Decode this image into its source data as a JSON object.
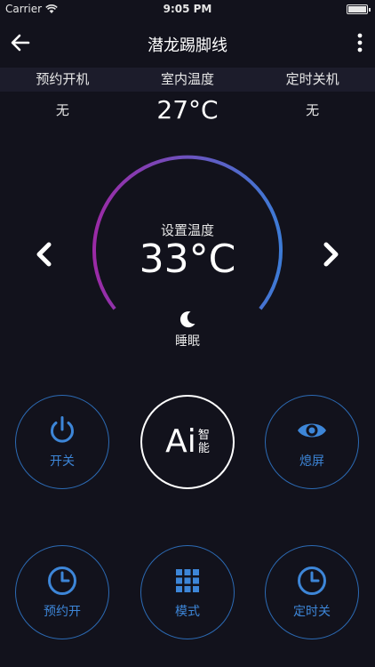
{
  "status_bar": {
    "carrier": "Carrier",
    "time": "9:05 PM"
  },
  "nav": {
    "title": "潜龙踢脚线",
    "back_icon": "back-arrow-icon",
    "more_icon": "more-vertical-icon"
  },
  "info": {
    "headers": [
      "预约开机",
      "室内温度",
      "定时关机"
    ],
    "values": [
      "无",
      "27°C",
      "无"
    ]
  },
  "dial": {
    "label": "设置温度",
    "value": "33°C"
  },
  "mode": {
    "label": "睡眠",
    "icon": "moon-icon"
  },
  "buttons": {
    "power": {
      "label": "开关",
      "icon": "power-icon"
    },
    "ai": {
      "text": "Ai",
      "sub1": "智",
      "sub2": "能"
    },
    "screen_off": {
      "label": "熄屏",
      "icon": "eye-icon"
    },
    "schedule_on": {
      "label": "预约开",
      "icon": "clock-icon"
    },
    "mode": {
      "label": "模式",
      "icon": "grid-icon"
    },
    "timer_off": {
      "label": "定时关",
      "icon": "clock-icon"
    }
  },
  "colors": {
    "accent_blue": "#3d86d8",
    "arc_start": "#9b2aa6",
    "arc_end": "#3d7bd6",
    "background": "#12121c"
  }
}
